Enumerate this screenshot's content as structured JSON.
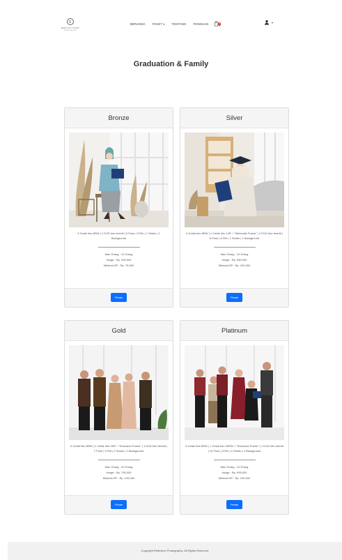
{
  "brand": {
    "name": "REFLECTION",
    "tagline": "PHOTOGRAPHY"
  },
  "nav": {
    "items": [
      {
        "label": "BERANDA"
      },
      {
        "label": "PAKET"
      },
      {
        "label": "TENTANG"
      },
      {
        "label": "PANDUAN"
      }
    ],
    "cart_count": "0"
  },
  "page_title": "Graduation & Family",
  "labels": {
    "max_orang": "Max Orang",
    "harga": "Harga",
    "minimal_dp": "Minimal DP",
    "button": "Pesan"
  },
  "packages": [
    {
      "name": "Bronze",
      "description": "3 Cetak foto 8RW | 1 DVD foto teredit | 5 Pose | 5 File | 1 Studio | 1 Background",
      "max_orang": "10 Orang",
      "harga": "Rp. 325,000",
      "minimal_dp": "Rp. 75,000"
    },
    {
      "name": "Silver",
      "description": "4 Cetak foto 8RW | 1 Cetak foto 12R + \"Minimalis Frame\" | 1 DVD foto teredit | 6 Pose | 6 File | 1 Studio | 1 Background",
      "max_orang": "10 Orang",
      "harga": "Rp. 480,000",
      "minimal_dp": "Rp. 100,000"
    },
    {
      "name": "Gold",
      "description": "4 Cetak foto 8RW | 1 Cetak foto 16R + \"Exclusive Frame\" | 1 DVD foto teredit | 7 Pose | 5 File | 2 Studio | 2 Background",
      "max_orang": "10 Orang",
      "harga": "Rp. 795,000",
      "minimal_dp": "Rp. 125,000"
    },
    {
      "name": "Platinum",
      "description": "5 Cetak foto 8RW | 1 Cetak foto 20RW + \"Exclusive Frame\" | 1 DVD foto teredit | 10 Pose | 8 File | 2 Studio | 2 Background",
      "max_orang": "10 Orang",
      "harga": "Rp. 995,000",
      "minimal_dp": "Rp. 150,000"
    }
  ],
  "footer": {
    "copyright": "Copyright Reflection Photography. All Rights Reserved"
  },
  "colors": {
    "primary": "#0d6efd",
    "badge": "#dc3545",
    "card_header": "#f5f5f5"
  }
}
